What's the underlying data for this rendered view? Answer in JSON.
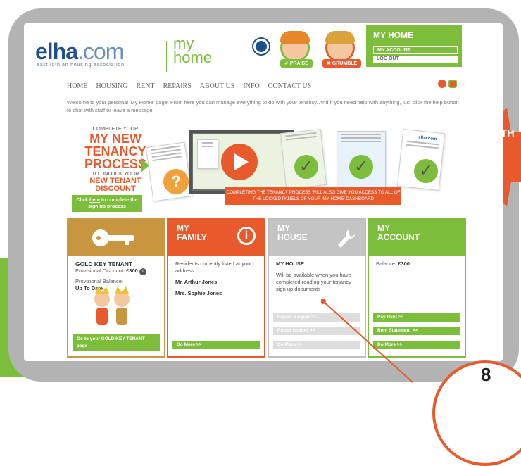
{
  "header": {
    "logo_text": "elha",
    "logo_dotcom": ".com",
    "logo_sub": "east lothian housing association",
    "myhome_line1": "my",
    "myhome_line2": "home",
    "praise_label": "✔ PRAISE",
    "grumble_label": "✖ GRUMBLE"
  },
  "account_panel": {
    "title": "MY HOME",
    "items": [
      "MY ACCOUNT",
      "LOG OUT"
    ]
  },
  "nav": [
    "HOME",
    "HOUSING",
    "RENT",
    "REPAIRS",
    "ABOUT US",
    "INFO",
    "CONTACT US"
  ],
  "welcome": "Welcome to your personal 'My Home' page. From here you can manage everything to do with your tenancy. And if you need help with anything, just click the help button to chat with staff or leave a message.",
  "tenancy": {
    "line1": "COMPLETE YOUR",
    "line2": "MY NEW TENANCY PROCESS",
    "line3": "TO UNLOCK YOUR",
    "line4": "NEW TENANT DISCOUNT",
    "click_pre": "Click ",
    "click_link": "here",
    "click_post": " to complete the sign up process",
    "banner": "COMPLETING THE TENANCY PROCESS WILL ALSO GIVE YOU ACCESS TO ALL OF THE LOCKED PANELS OF YOUR 'MY HOME' DASHBOARD",
    "doc_logo": "elha.com"
  },
  "arrow_text": "TH",
  "cards": {
    "gold": {
      "title": "GOLD KEY TENANT",
      "discount_label": "Provisional Discount: ",
      "discount_value": "£300",
      "balance_label": "Provisional Balance:",
      "balance_value": "Up To Date",
      "btn_pre": "Go to your ",
      "btn_link": "GOLD KEY TENANT",
      "btn_post": " page"
    },
    "family": {
      "head1": "MY",
      "head2": "FAMILY",
      "desc": "Residents currently listed at your address",
      "residents": [
        "Mr. Arthur Jones",
        "Mrs. Sophie Jones"
      ],
      "btn": "Do More >>"
    },
    "house": {
      "head1": "MY",
      "head2": "HOUSE",
      "title": "MY HOUSE",
      "desc": "Will be available when you have completed reading your tenancy sign up documents",
      "btns": [
        "Report a repair >>",
        "Repair history >>",
        "Do More >>"
      ]
    },
    "account": {
      "head1": "MY",
      "head2": "ACCOUNT",
      "balance_label": "Balance: ",
      "balance_value": "£300",
      "btns": [
        "Pay Rent >>",
        "Rent Statement >>",
        "Do More >>"
      ]
    }
  },
  "callout_number": "8",
  "colors": {
    "green": "#7cbd3c",
    "orange": "#e85a2c",
    "gold": "#c8963e",
    "grey": "#c4c4c4",
    "navy": "#1f4e8c"
  }
}
